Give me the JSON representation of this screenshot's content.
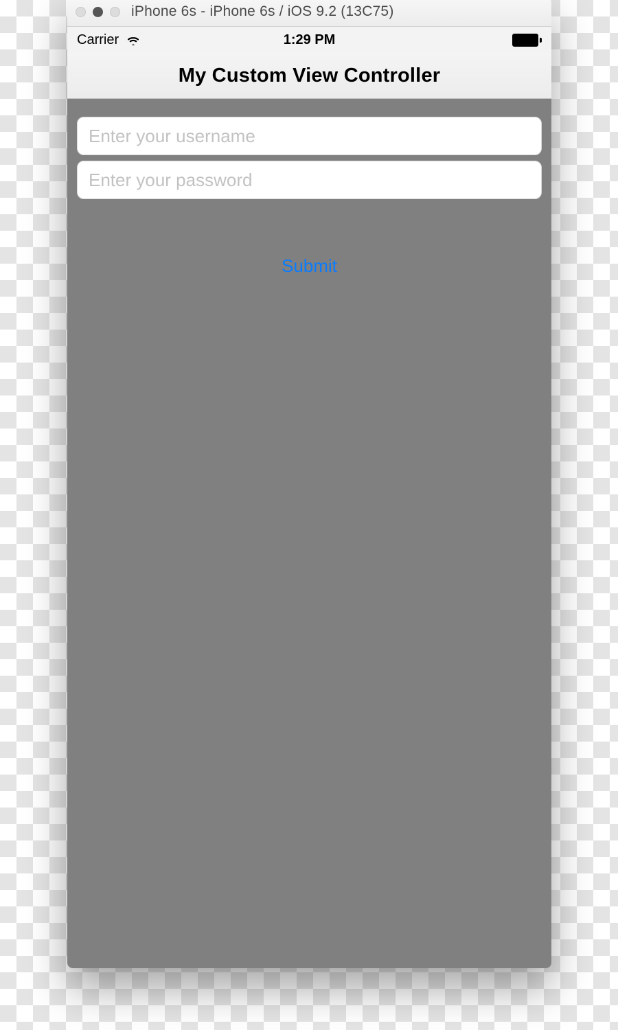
{
  "window": {
    "title": "iPhone 6s - iPhone 6s / iOS 9.2 (13C75)"
  },
  "statusbar": {
    "carrier": "Carrier",
    "time": "1:29 PM"
  },
  "navbar": {
    "title": "My Custom View Controller"
  },
  "form": {
    "username_placeholder": "Enter your username",
    "password_placeholder": "Enter your password",
    "submit_label": "Submit"
  },
  "colors": {
    "link": "#0a7cff",
    "content_bg": "#808080"
  }
}
